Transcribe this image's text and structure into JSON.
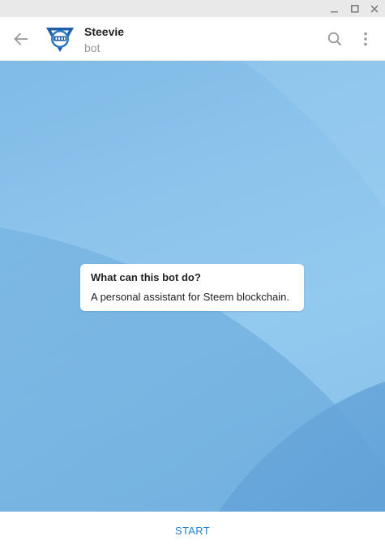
{
  "window": {
    "controls": [
      "minimize-icon",
      "maximize-icon",
      "close-icon"
    ]
  },
  "header": {
    "back_icon": "arrow-left-icon",
    "chat_title": "Steevie",
    "chat_status": "bot",
    "search_icon": "search-icon",
    "menu_icon": "more-vertical-icon"
  },
  "intro_card": {
    "title": "What can this bot do?",
    "description": "A personal assistant for Steem blockchain."
  },
  "bottom": {
    "start_label": "START"
  },
  "colors": {
    "accent": "#2481cc",
    "chat_background": "#8cc4ec",
    "avatar_blue": "#1f5fa8"
  }
}
